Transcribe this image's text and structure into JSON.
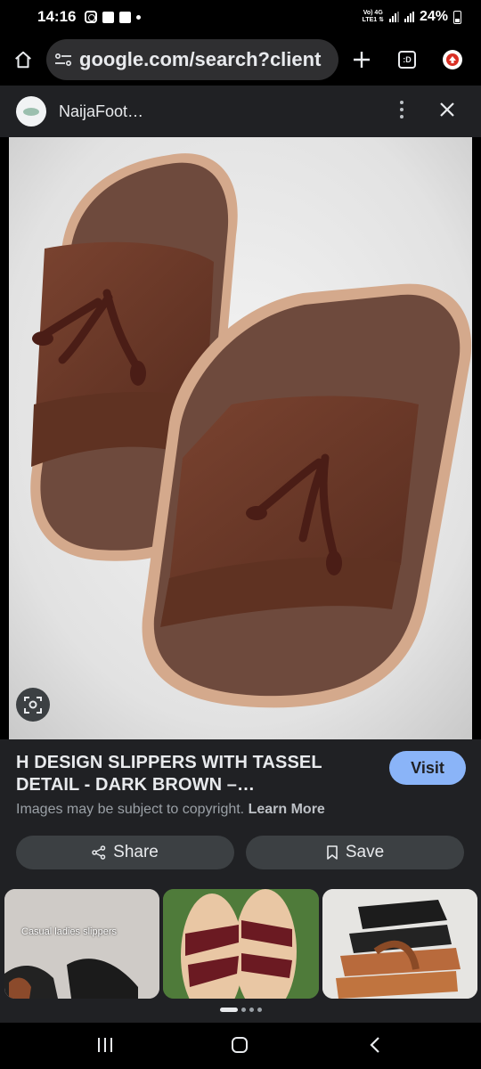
{
  "status_bar": {
    "time": "14:16",
    "network_top": "Vo) 4G",
    "network_bottom": "LTE1 ⇅",
    "battery": "24%"
  },
  "browser": {
    "url": "google.com/search?client",
    "tab_count": ":D"
  },
  "viewer": {
    "site_name": "NaijaFoot…"
  },
  "result": {
    "title": "H DESIGN SLIPPERS WITH TASSEL DETAIL - DARK BROWN –…",
    "visit_label": "Visit",
    "copyright_text": "Images may be subject to copyright.",
    "learn_more": "Learn More",
    "share_label": "Share",
    "save_label": "Save"
  },
  "related": {
    "thumb1_caption": "Casual ladies slippers",
    "page_dots": 4,
    "active_dot": 0
  },
  "colors": {
    "panel_bg": "#202124",
    "visit_bg": "#8ab4f8",
    "button_bg": "#3c4043",
    "leather": "#6b3a2a"
  }
}
